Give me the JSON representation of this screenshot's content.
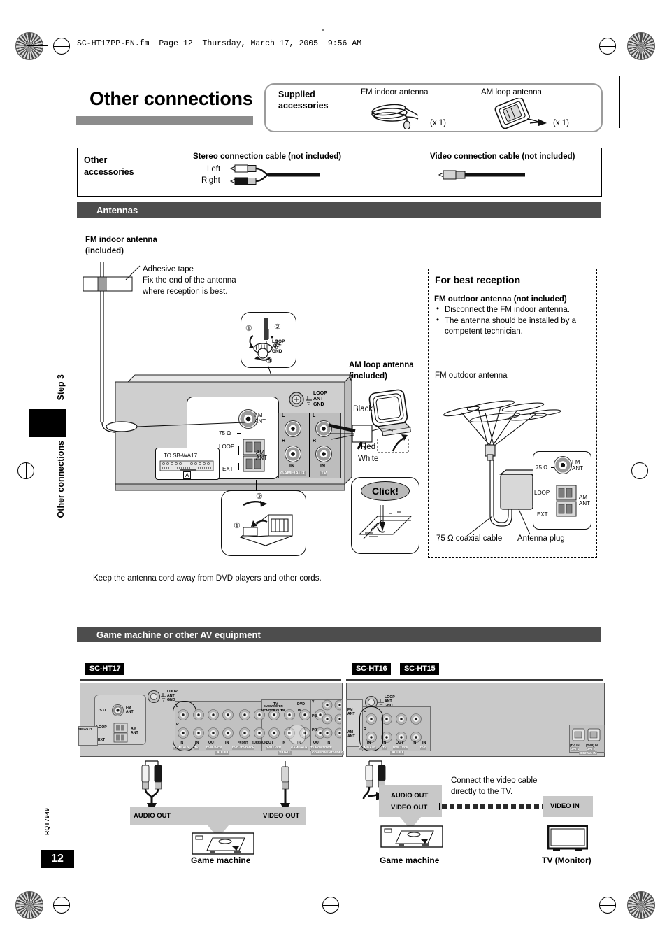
{
  "print": {
    "filename_line": "SC-HT17PP-EN.fm  Page 12  Thursday, March 17, 2005  9:56 AM"
  },
  "sidebar": {
    "step": "Step 3",
    "section": "Other connections",
    "rqt_code": "RQT7949",
    "page_number": "12"
  },
  "header": {
    "title": "Other connections"
  },
  "supplied": {
    "label_line1": "Supplied",
    "label_line2": "accessories",
    "items": [
      {
        "name": "FM indoor antenna",
        "qty": "(x 1)"
      },
      {
        "name": "AM loop antenna",
        "qty": "(x 1)"
      }
    ]
  },
  "other_accessories": {
    "label_line1": "Other",
    "label_line2": "accessories",
    "stereo_cable": {
      "title": "Stereo connection cable (not included)",
      "left": "Left",
      "right": "Right"
    },
    "video_cable": {
      "title": "Video connection cable (not included)"
    }
  },
  "antennas": {
    "section_title": "Antennas",
    "fm_indoor_heading_line1": "FM indoor antenna",
    "fm_indoor_heading_line2": "(included)",
    "adhesive_line1": "Adhesive tape",
    "adhesive_line2": "Fix the end of the antenna",
    "adhesive_line3": "where reception is best.",
    "am_loop_heading_line1": "AM loop antenna",
    "am_loop_heading_line2": "(included)",
    "wire_colors": [
      "Black",
      "Red",
      "White"
    ],
    "click_label": "Click!",
    "steps": [
      "1",
      "2",
      "3"
    ],
    "terminal_labels": {
      "impedance": "75 Ω",
      "fm_ant_line1": "FM",
      "fm_ant_line2": "ANT",
      "am_ant_line1": "AM",
      "am_ant_line2": "ANT",
      "loop": "LOOP",
      "ext": "EXT",
      "loop_ant_gnd_l1": "LOOP",
      "loop_ant_gnd_l2": "ANT",
      "loop_ant_gnd_l3": "GND",
      "sb_wa17": "TO SB-WA17",
      "sb_wa17_key": "A",
      "in": "IN",
      "game_aux": "GAME/AUX",
      "tv": "TV",
      "ch_l": "L",
      "ch_r": "R"
    },
    "footnote": "Keep the antenna cord away from DVD players and other cords."
  },
  "best_reception": {
    "title": "For best reception",
    "subtitle": "FM outdoor antenna (not included)",
    "bullets": [
      "Disconnect the FM indoor antenna.",
      "The antenna should be installed by a competent technician."
    ],
    "outdoor_caption": "FM outdoor antenna",
    "coax_caption": "75 Ω coaxial cable",
    "plug_caption": "Antenna plug"
  },
  "game_section": {
    "section_title": "Game machine or other AV equipment",
    "left": {
      "badge": "SC-HT17",
      "audio_out": "AUDIO OUT",
      "video_out": "VIDEO OUT",
      "device": "Game machine",
      "panel": {
        "loop_ant_gnd": [
          "LOOP",
          "ANT",
          "GND"
        ],
        "fm": [
          "75 Ω",
          "FM",
          "ANT"
        ],
        "am": [
          "LOOP",
          "EXT",
          "AM",
          "ANT"
        ],
        "sb": "SB-WA17",
        "audio_bus": "AUDIO",
        "video_bus": "VIDEO",
        "component_bus": "COMPONENT VIDEO",
        "audio_groups": [
          {
            "name": "GAME/AUX",
            "jacks": [
              "IN"
            ]
          },
          {
            "name": "TV",
            "jacks": [
              "IN"
            ]
          },
          {
            "name": "DVR / VCR",
            "jacks": [
              "OUT",
              "IN"
            ]
          },
          {
            "name": "DVD / DVD 6CH",
            "jacks": [
              "FRONT",
              "SURROUND",
              "SUBWOOFER"
            ]
          }
        ],
        "video_groups": [
          {
            "name": "TV",
            "jacks": [
              "MONITOR OUT",
              "IN"
            ]
          },
          {
            "name": "DVD",
            "jacks": [
              "IN"
            ]
          },
          {
            "name": "DVR / VCR",
            "jacks": [
              "OUT",
              "IN"
            ]
          },
          {
            "name": "GAME/AUX",
            "jacks": [
              "IN"
            ]
          }
        ],
        "component_groups": [
          {
            "name": "TV MONITOR",
            "jacks": [
              "OUT"
            ]
          },
          {
            "name": "DVR",
            "jacks": [
              "IN"
            ]
          },
          {
            "name": "TV",
            "jacks": [
              "IN"
            ]
          }
        ],
        "component_rows": [
          "Y",
          "PB",
          "PR"
        ]
      }
    },
    "right": {
      "badges": [
        "SC-HT16",
        "SC-HT15"
      ],
      "note_line1": "Connect the video cable",
      "note_line2": "directly to the TV.",
      "audio_out": "AUDIO OUT",
      "video_out": "VIDEO OUT",
      "video_in": "VIDEO IN",
      "device": "Game machine",
      "tv": "TV (Monitor)",
      "panel": {
        "loop_ant_gnd": [
          "LOOP",
          "ANT",
          "GND"
        ],
        "fm": [
          "FM",
          "ANT"
        ],
        "am": [
          "AM",
          "ANT"
        ],
        "audio_bus": "AUDIO",
        "digital_bus": "DIGITAL IN",
        "audio_groups": [
          {
            "name": "GAME/AUX",
            "jacks": [
              "IN"
            ]
          },
          {
            "name": "TV",
            "jacks": [
              "IN"
            ]
          },
          {
            "name": "DVR / VCR",
            "jacks": [
              "OUT",
              "IN"
            ]
          },
          {
            "name": "DVD",
            "jacks": [
              "IN"
            ]
          }
        ],
        "digital_jacks": [
          {
            "src": "(TV) IN",
            "opt": "OPT 1"
          },
          {
            "src": "(DVR) IN",
            "opt": "OPT 2"
          }
        ]
      }
    }
  },
  "colors": {
    "section_bar": "#4d4d4d",
    "title_bar": "#8c8c8c",
    "panel_gray": "#c9c9c9",
    "band_gray": "#c8c8c8"
  }
}
